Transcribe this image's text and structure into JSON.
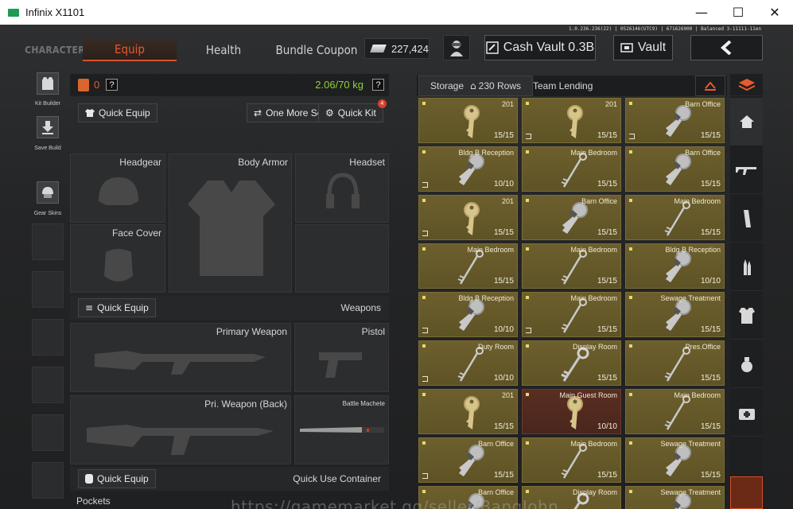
{
  "window": {
    "title": "Infinix X1101",
    "controls": [
      "minimize",
      "maximize",
      "close"
    ]
  },
  "version": "1.0.236.236(22) | 0526146(UTC9) | 671626000 | Balanced 3-11111-11en",
  "nav": {
    "tabs": [
      "CHARACTER",
      "Equip",
      "Health",
      "Bundle Coupon"
    ],
    "active_tab": "Equip",
    "currency": "227,424",
    "cash_vault": "Cash Vault 0.3B",
    "vault": "Vault"
  },
  "left_bar": {
    "kit_builder": "Kit Builder",
    "save_build": "Save Build",
    "gear_skins": "Gear Skins"
  },
  "equip": {
    "backpack_count": "0",
    "weight": "2.06/70 kg",
    "quick_equip": "Quick Equip",
    "one_more_set": "One More Set",
    "quick_kit": "Quick Kit",
    "quick_kit_badge": "4",
    "slots": {
      "headgear": "Headgear",
      "body_armor": "Body Armor",
      "headset": "Headset",
      "face_cover": "Face Cover"
    },
    "weapons": {
      "section": "Weapons",
      "quick_equip": "Quick Equip",
      "primary": "Primary Weapon",
      "pistol": "Pistol",
      "back": "Pri. Weapon (Back)",
      "melee": "Battle Machete"
    },
    "container": {
      "quick_equip": "Quick Equip",
      "label": "Quick Use Container"
    },
    "pockets": "Pockets"
  },
  "storage": {
    "tab": "Storage",
    "rows": "230 Rows",
    "team_lending": "Team Lending",
    "items": [
      {
        "name": "201",
        "count": "15/15",
        "color": "gold",
        "exit": false
      },
      {
        "name": "201",
        "count": "15/15",
        "color": "gold",
        "exit": true
      },
      {
        "name": "Barn Office",
        "count": "15/15",
        "color": "silver",
        "exit": true
      },
      {
        "name": "Bldg B Reception",
        "count": "10/10",
        "color": "silver",
        "exit": true
      },
      {
        "name": "Main Bedroom",
        "count": "15/15",
        "color": "thin",
        "exit": false
      },
      {
        "name": "Barn Office",
        "count": "15/15",
        "color": "silver",
        "exit": false
      },
      {
        "name": "201",
        "count": "15/15",
        "color": "gold",
        "exit": true
      },
      {
        "name": "Barn Office",
        "count": "15/15",
        "color": "silver",
        "exit": false
      },
      {
        "name": "Main Bedroom",
        "count": "15/15",
        "color": "thin",
        "exit": false
      },
      {
        "name": "Main Bedroom",
        "count": "15/15",
        "color": "thin",
        "exit": false
      },
      {
        "name": "Main Bedroom",
        "count": "15/15",
        "color": "thin",
        "exit": false
      },
      {
        "name": "Bldg B Reception",
        "count": "10/10",
        "color": "silver",
        "exit": false
      },
      {
        "name": "Bldg B Reception",
        "count": "10/10",
        "color": "silver",
        "exit": true
      },
      {
        "name": "Main Bedroom",
        "count": "15/15",
        "color": "thin",
        "exit": true
      },
      {
        "name": "Sewage Treatment",
        "count": "15/15",
        "color": "silver",
        "exit": false
      },
      {
        "name": "Duty Room",
        "count": "10/10",
        "color": "thin",
        "exit": true
      },
      {
        "name": "Display Room",
        "count": "15/15",
        "color": "ornate",
        "exit": false
      },
      {
        "name": "Pres.Office",
        "count": "15/15",
        "color": "thin",
        "exit": false
      },
      {
        "name": "201",
        "count": "15/15",
        "color": "gold",
        "exit": false
      },
      {
        "name": "Main Guest Room",
        "count": "10/10",
        "color": "gold",
        "exit": false,
        "red": true
      },
      {
        "name": "Main Bedroom",
        "count": "15/15",
        "color": "thin",
        "exit": false
      },
      {
        "name": "Barn Office",
        "count": "15/15",
        "color": "silver",
        "exit": true
      },
      {
        "name": "Main Bedroom",
        "count": "15/15",
        "color": "thin",
        "exit": false
      },
      {
        "name": "Sewage Treatment",
        "count": "15/15",
        "color": "silver",
        "exit": false
      },
      {
        "name": "Barn Office",
        "count": "",
        "color": "silver",
        "exit": false
      },
      {
        "name": "Display Room",
        "count": "",
        "color": "ornate",
        "exit": false
      },
      {
        "name": "Sewage Treatment",
        "count": "",
        "color": "silver",
        "exit": false
      }
    ]
  },
  "right_bar": {
    "icons": [
      "storage-top-icon",
      "home-icon",
      "rifle-icon",
      "magazine-icon",
      "ammo-icon",
      "armor-icon",
      "grenade-icon",
      "medical-icon",
      "selected-category-icon"
    ]
  },
  "watermark": "https://gamemarket.gg/seller/BangJohn",
  "colors": {
    "accent": "#e45a30",
    "weight_ok": "#8fd13b",
    "key_tile": "#6d5f2d",
    "key_tile_red": "#5a2e22"
  }
}
